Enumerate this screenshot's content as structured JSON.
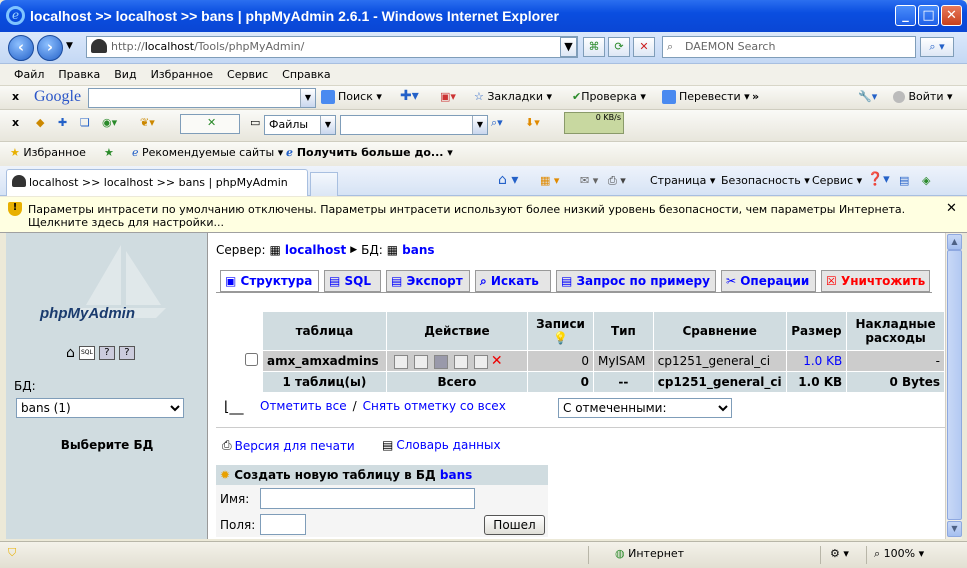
{
  "window": {
    "title": "localhost >> localhost >> bans | phpMyAdmin 2.6.1 - Windows Internet Explorer"
  },
  "address": {
    "prefix": "http://",
    "host": "localhost",
    "path": "/Tools/phpMyAdmin/"
  },
  "search": {
    "placeholder": "DAEMON Search"
  },
  "menu": [
    "Файл",
    "Правка",
    "Вид",
    "Избранное",
    "Сервис",
    "Справка"
  ],
  "google_toolbar": {
    "logo": "Google",
    "search": "Поиск",
    "bookmarks": "Закладки",
    "check": "Проверка",
    "translate": "Перевести",
    "login": "Войти"
  },
  "toolbar2": {
    "files": "Файлы",
    "speed": "0 KB/s"
  },
  "favbar": {
    "favorites": "Избранное",
    "recommended": "Рекомендуемые сайты",
    "get_more": "Получить больше до..."
  },
  "tab": {
    "title": "localhost >> localhost >> bans | phpMyAdmin 2.6.1"
  },
  "cmdbar": {
    "page": "Страница",
    "security": "Безопасность",
    "service": "Сервис"
  },
  "infobar": {
    "text": "Параметры интрасети по умолчанию отключены. Параметры интрасети используют более низкий уровень безопасности, чем параметры Интернета. Щелкните здесь для настройки..."
  },
  "left": {
    "logo": "phpMyAdmin",
    "db_label": "БД:",
    "db_value": "bans (1)",
    "choose": "Выберите БД"
  },
  "crumb": {
    "server_label": "Сервер:",
    "server": "localhost",
    "db_label": "БД:",
    "db": "bans"
  },
  "pma_tabs": [
    "Структура",
    "SQL",
    "Экспорт",
    "Искать",
    "Запрос по примеру",
    "Операции",
    "Уничтожить"
  ],
  "table": {
    "headers": {
      "table": "таблица",
      "action": "Действие",
      "records": "Записи",
      "type": "Тип",
      "collation": "Сравнение",
      "size": "Размер",
      "overhead_1": "Накладные",
      "overhead_2": "расходы"
    },
    "row": {
      "name": "amx_amxadmins",
      "records": "0",
      "type": "MyISAM",
      "collation": "cp1251_general_ci",
      "size": "1.0 KB",
      "overhead": "-"
    },
    "total": {
      "name": "1 таблиц(ы)",
      "label": "Всего",
      "records": "0",
      "type": "--",
      "collation": "cp1251_general_ci",
      "size": "1.0 KB",
      "overhead": "0 Bytes"
    }
  },
  "check": {
    "all": "Отметить все",
    "sep": "/",
    "none": "Снять отметку со всех",
    "with_selected": "С отмеченными:"
  },
  "links": {
    "print": "Версия для печати",
    "dict": "Словарь данных"
  },
  "create": {
    "title": "Создать новую таблицу в БД",
    "db": "bans",
    "name_label": "Имя:",
    "fields_label": "Поля:",
    "go": "Пошел"
  },
  "status": {
    "zone": "Интернет",
    "zoom": "100%"
  }
}
